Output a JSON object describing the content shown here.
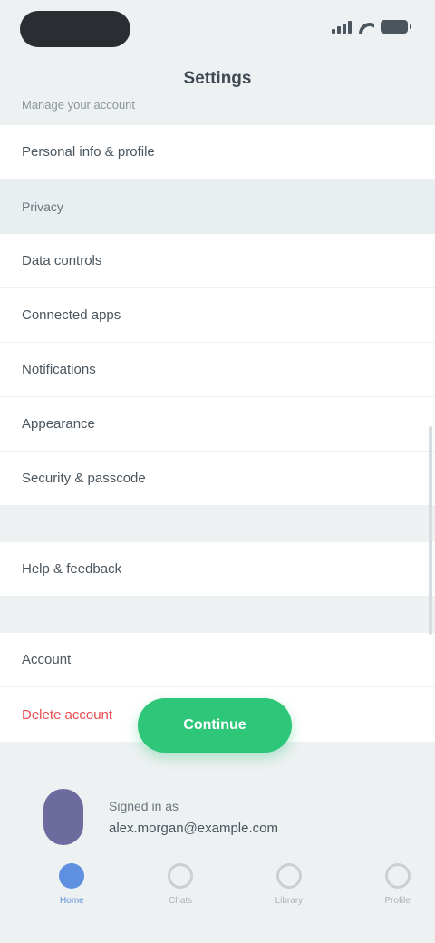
{
  "status_bar": {
    "time": "",
    "icons": [
      "signal-icon",
      "wifi-icon",
      "battery-icon"
    ]
  },
  "header": {
    "title": "Settings",
    "note": "Manage your account"
  },
  "rows": {
    "profile": "Personal info & profile",
    "section_label": "Privacy",
    "item_1": "Data controls",
    "item_2": "Connected apps",
    "item_3": "Notifications",
    "item_4": "Appearance",
    "item_5": "Security & passcode",
    "item_6": "Help & feedback",
    "section_label_2": "Account",
    "danger": "Delete account"
  },
  "cta": {
    "label": "Continue"
  },
  "account": {
    "name": "Signed in as",
    "email": "alex.morgan@example.com"
  },
  "nav": {
    "items": [
      {
        "label": "Home",
        "icon": "home-icon"
      },
      {
        "label": "Chats",
        "icon": "chat-icon"
      },
      {
        "label": "Library",
        "icon": "library-icon"
      },
      {
        "label": "Profile",
        "icon": "profile-icon"
      }
    ]
  },
  "colors": {
    "accent": "#5f8fe0",
    "cta": "#2ec77a",
    "danger": "#e84c50",
    "background": "#eef1f2"
  }
}
